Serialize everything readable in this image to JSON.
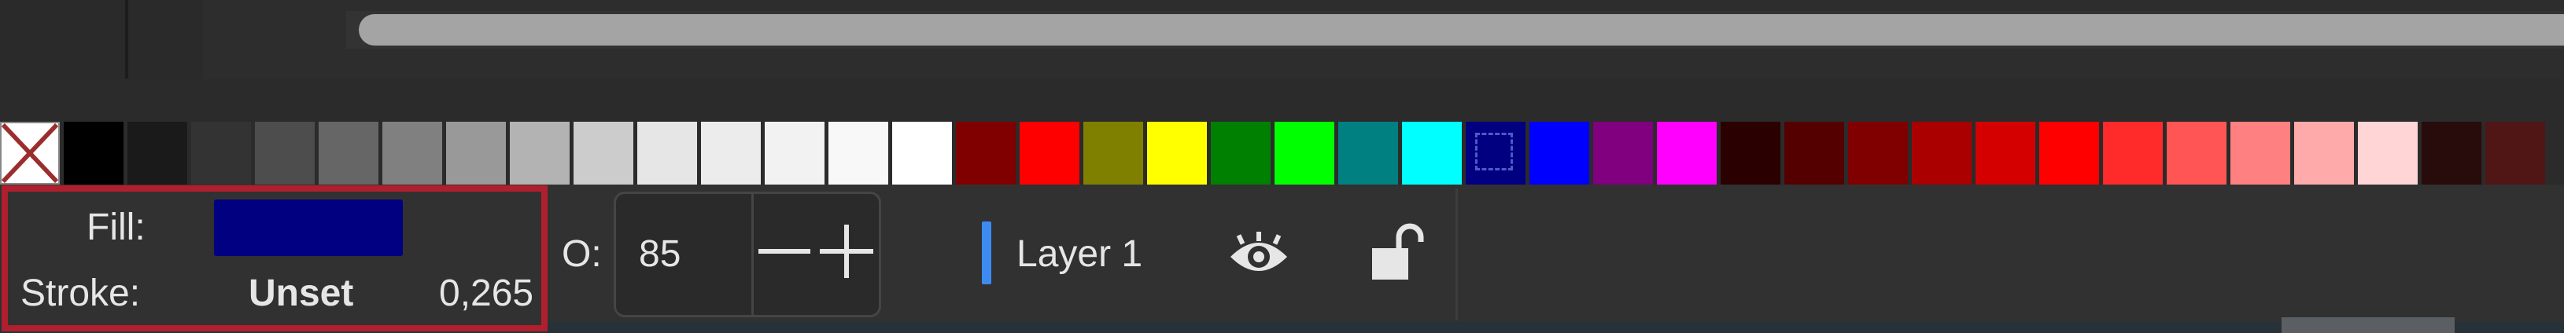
{
  "fill_stroke": {
    "fill_label": "Fill:",
    "fill_color": "#000080",
    "stroke_label": "Stroke:",
    "stroke_value": "Unset",
    "stroke_width": "0,265",
    "highlight_color": "#b01f2e"
  },
  "opacity": {
    "label": "O:",
    "value": "85"
  },
  "layer": {
    "name": "Layer 1",
    "indicator_color": "#3d8bf0",
    "visibility_icon": "eye-icon",
    "lock_icon": "unlocked-lock-icon"
  },
  "palette": {
    "none_swatch": "none",
    "selected_color": "#000080",
    "colors": [
      "#000000",
      "#1a1a1a",
      "#333333",
      "#4d4d4d",
      "#666666",
      "#808080",
      "#999999",
      "#b3b3b3",
      "#cccccc",
      "#e6e6e6",
      "#ececec",
      "#f2f2f2",
      "#f8f8f8",
      "#ffffff",
      "#800000",
      "#ff0000",
      "#808000",
      "#ffff00",
      "#008000",
      "#00ff00",
      "#008080",
      "#00ffff",
      "#000080",
      "#0000ff",
      "#800080",
      "#ff00ff",
      "#2b0000",
      "#550000",
      "#800000",
      "#aa0000",
      "#d40000",
      "#ff0000",
      "#ff2a2a",
      "#ff5555",
      "#ff8080",
      "#ffaaaa",
      "#ffd5d5",
      "#280b0b",
      "#501616"
    ]
  }
}
